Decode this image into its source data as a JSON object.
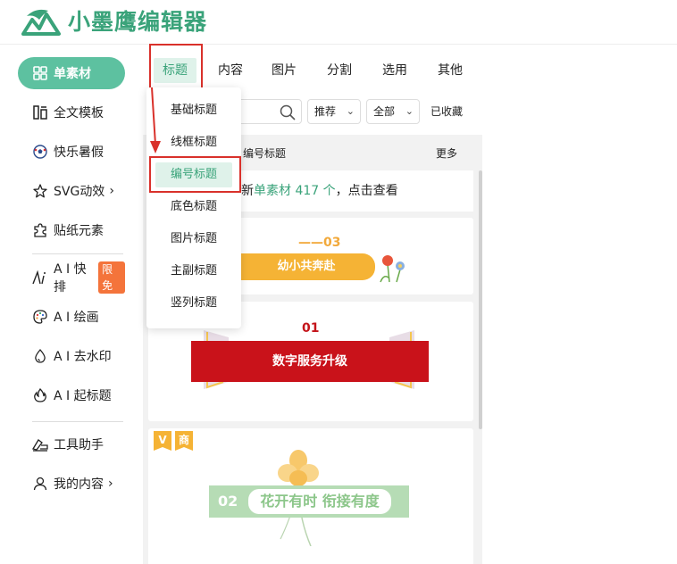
{
  "app": {
    "title": "小墨鹰编辑器"
  },
  "sidebar": {
    "items": [
      {
        "label": "单素材",
        "icon": "grid-icon",
        "active": true
      },
      {
        "label": "全文模板",
        "icon": "document-layout-icon"
      },
      {
        "label": "快乐暑假",
        "icon": "soccer-ball-icon"
      },
      {
        "label": "SVG动效",
        "icon": "star-outline-icon",
        "chevron": "›"
      },
      {
        "label": "贴纸元素",
        "icon": "puzzle-icon"
      },
      {
        "label": "A I 快排",
        "icon": "ai-icon",
        "badge": "限免"
      },
      {
        "label": "A I 绘画",
        "icon": "palette-icon"
      },
      {
        "label": "A I 去水印",
        "icon": "water-drop-icon"
      },
      {
        "label": "A I 起标题",
        "icon": "flame-icon"
      },
      {
        "label": "工具助手",
        "icon": "tools-icon"
      },
      {
        "label": "我的内容",
        "icon": "user-icon",
        "chevron": "›"
      }
    ]
  },
  "tabs": [
    {
      "label": "标题",
      "active": true
    },
    {
      "label": "内容"
    },
    {
      "label": "图片"
    },
    {
      "label": "分割"
    },
    {
      "label": "选用"
    },
    {
      "label": "其他"
    }
  ],
  "filters": {
    "search_placeholder": "",
    "sort": "推荐",
    "scope": "全部",
    "favorites": "已收藏",
    "chevron": "⌄"
  },
  "subheader": {
    "title": "编号标题",
    "more": "更多"
  },
  "notice": {
    "prefix": "新",
    "highlight": "单素材 417 个",
    "suffix": "，点击查看"
  },
  "dropdown": {
    "items": [
      {
        "label": "基础标题"
      },
      {
        "label": "线框标题"
      },
      {
        "label": "编号标题",
        "active": true
      },
      {
        "label": "底色标题"
      },
      {
        "label": "图片标题"
      },
      {
        "label": "主副标题"
      },
      {
        "label": "竖列标题"
      }
    ]
  },
  "cards": [
    {
      "number": "——03",
      "text": "幼小共奔赴",
      "accent": "#f5b335"
    },
    {
      "number": "01",
      "text": "数字服务升级",
      "accent": "#c9121a"
    },
    {
      "number": "02",
      "text": "花开有时 衔接有度",
      "tags": [
        "V",
        "商"
      ],
      "accent": "#b6dcb5"
    }
  ],
  "colors": {
    "brand": "#3aa37a",
    "brand_light": "#5dc1a0",
    "highlight_border": "#d9312b"
  }
}
